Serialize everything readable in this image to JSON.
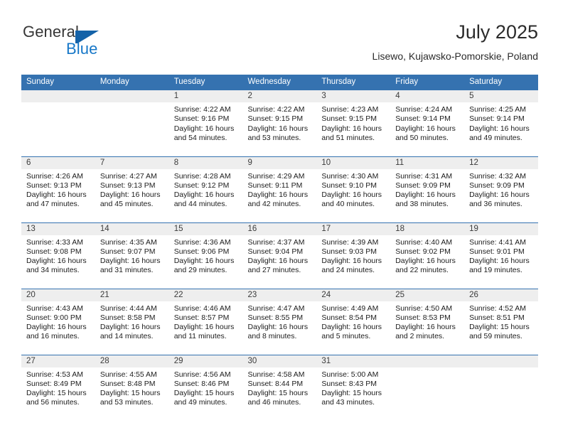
{
  "brand": {
    "name_top": "General",
    "name_bottom": "Blue",
    "flag_icon": "blue-flag-triangle-icon",
    "color_dark": "#363636",
    "color_blue": "#1878c8"
  },
  "header": {
    "title": "July 2025",
    "location": "Lisewo, Kujawsko-Pomorskie, Poland"
  },
  "theme": {
    "header_blue": "#3572b0",
    "daynum_band": "#eeeeee",
    "text": "#1c1c1c"
  },
  "labels": {
    "sunrise_prefix": "Sunrise:",
    "sunset_prefix": "Sunset:",
    "daylight_prefix": "Daylight:"
  },
  "weekdays": [
    "Sunday",
    "Monday",
    "Tuesday",
    "Wednesday",
    "Thursday",
    "Friday",
    "Saturday"
  ],
  "weeks": [
    [
      {
        "day": "",
        "empty": true
      },
      {
        "day": "",
        "empty": true
      },
      {
        "day": "1",
        "sunrise": "Sunrise: 4:22 AM",
        "sunset": "Sunset: 9:16 PM",
        "daylight_l1": "Daylight: 16 hours",
        "daylight_l2": "and 54 minutes."
      },
      {
        "day": "2",
        "sunrise": "Sunrise: 4:22 AM",
        "sunset": "Sunset: 9:15 PM",
        "daylight_l1": "Daylight: 16 hours",
        "daylight_l2": "and 53 minutes."
      },
      {
        "day": "3",
        "sunrise": "Sunrise: 4:23 AM",
        "sunset": "Sunset: 9:15 PM",
        "daylight_l1": "Daylight: 16 hours",
        "daylight_l2": "and 51 minutes."
      },
      {
        "day": "4",
        "sunrise": "Sunrise: 4:24 AM",
        "sunset": "Sunset: 9:14 PM",
        "daylight_l1": "Daylight: 16 hours",
        "daylight_l2": "and 50 minutes."
      },
      {
        "day": "5",
        "sunrise": "Sunrise: 4:25 AM",
        "sunset": "Sunset: 9:14 PM",
        "daylight_l1": "Daylight: 16 hours",
        "daylight_l2": "and 49 minutes."
      }
    ],
    [
      {
        "day": "6",
        "sunrise": "Sunrise: 4:26 AM",
        "sunset": "Sunset: 9:13 PM",
        "daylight_l1": "Daylight: 16 hours",
        "daylight_l2": "and 47 minutes."
      },
      {
        "day": "7",
        "sunrise": "Sunrise: 4:27 AM",
        "sunset": "Sunset: 9:13 PM",
        "daylight_l1": "Daylight: 16 hours",
        "daylight_l2": "and 45 minutes."
      },
      {
        "day": "8",
        "sunrise": "Sunrise: 4:28 AM",
        "sunset": "Sunset: 9:12 PM",
        "daylight_l1": "Daylight: 16 hours",
        "daylight_l2": "and 44 minutes."
      },
      {
        "day": "9",
        "sunrise": "Sunrise: 4:29 AM",
        "sunset": "Sunset: 9:11 PM",
        "daylight_l1": "Daylight: 16 hours",
        "daylight_l2": "and 42 minutes."
      },
      {
        "day": "10",
        "sunrise": "Sunrise: 4:30 AM",
        "sunset": "Sunset: 9:10 PM",
        "daylight_l1": "Daylight: 16 hours",
        "daylight_l2": "and 40 minutes."
      },
      {
        "day": "11",
        "sunrise": "Sunrise: 4:31 AM",
        "sunset": "Sunset: 9:09 PM",
        "daylight_l1": "Daylight: 16 hours",
        "daylight_l2": "and 38 minutes."
      },
      {
        "day": "12",
        "sunrise": "Sunrise: 4:32 AM",
        "sunset": "Sunset: 9:09 PM",
        "daylight_l1": "Daylight: 16 hours",
        "daylight_l2": "and 36 minutes."
      }
    ],
    [
      {
        "day": "13",
        "sunrise": "Sunrise: 4:33 AM",
        "sunset": "Sunset: 9:08 PM",
        "daylight_l1": "Daylight: 16 hours",
        "daylight_l2": "and 34 minutes."
      },
      {
        "day": "14",
        "sunrise": "Sunrise: 4:35 AM",
        "sunset": "Sunset: 9:07 PM",
        "daylight_l1": "Daylight: 16 hours",
        "daylight_l2": "and 31 minutes."
      },
      {
        "day": "15",
        "sunrise": "Sunrise: 4:36 AM",
        "sunset": "Sunset: 9:06 PM",
        "daylight_l1": "Daylight: 16 hours",
        "daylight_l2": "and 29 minutes."
      },
      {
        "day": "16",
        "sunrise": "Sunrise: 4:37 AM",
        "sunset": "Sunset: 9:04 PM",
        "daylight_l1": "Daylight: 16 hours",
        "daylight_l2": "and 27 minutes."
      },
      {
        "day": "17",
        "sunrise": "Sunrise: 4:39 AM",
        "sunset": "Sunset: 9:03 PM",
        "daylight_l1": "Daylight: 16 hours",
        "daylight_l2": "and 24 minutes."
      },
      {
        "day": "18",
        "sunrise": "Sunrise: 4:40 AM",
        "sunset": "Sunset: 9:02 PM",
        "daylight_l1": "Daylight: 16 hours",
        "daylight_l2": "and 22 minutes."
      },
      {
        "day": "19",
        "sunrise": "Sunrise: 4:41 AM",
        "sunset": "Sunset: 9:01 PM",
        "daylight_l1": "Daylight: 16 hours",
        "daylight_l2": "and 19 minutes."
      }
    ],
    [
      {
        "day": "20",
        "sunrise": "Sunrise: 4:43 AM",
        "sunset": "Sunset: 9:00 PM",
        "daylight_l1": "Daylight: 16 hours",
        "daylight_l2": "and 16 minutes."
      },
      {
        "day": "21",
        "sunrise": "Sunrise: 4:44 AM",
        "sunset": "Sunset: 8:58 PM",
        "daylight_l1": "Daylight: 16 hours",
        "daylight_l2": "and 14 minutes."
      },
      {
        "day": "22",
        "sunrise": "Sunrise: 4:46 AM",
        "sunset": "Sunset: 8:57 PM",
        "daylight_l1": "Daylight: 16 hours",
        "daylight_l2": "and 11 minutes."
      },
      {
        "day": "23",
        "sunrise": "Sunrise: 4:47 AM",
        "sunset": "Sunset: 8:55 PM",
        "daylight_l1": "Daylight: 16 hours",
        "daylight_l2": "and 8 minutes."
      },
      {
        "day": "24",
        "sunrise": "Sunrise: 4:49 AM",
        "sunset": "Sunset: 8:54 PM",
        "daylight_l1": "Daylight: 16 hours",
        "daylight_l2": "and 5 minutes."
      },
      {
        "day": "25",
        "sunrise": "Sunrise: 4:50 AM",
        "sunset": "Sunset: 8:53 PM",
        "daylight_l1": "Daylight: 16 hours",
        "daylight_l2": "and 2 minutes."
      },
      {
        "day": "26",
        "sunrise": "Sunrise: 4:52 AM",
        "sunset": "Sunset: 8:51 PM",
        "daylight_l1": "Daylight: 15 hours",
        "daylight_l2": "and 59 minutes."
      }
    ],
    [
      {
        "day": "27",
        "sunrise": "Sunrise: 4:53 AM",
        "sunset": "Sunset: 8:49 PM",
        "daylight_l1": "Daylight: 15 hours",
        "daylight_l2": "and 56 minutes."
      },
      {
        "day": "28",
        "sunrise": "Sunrise: 4:55 AM",
        "sunset": "Sunset: 8:48 PM",
        "daylight_l1": "Daylight: 15 hours",
        "daylight_l2": "and 53 minutes."
      },
      {
        "day": "29",
        "sunrise": "Sunrise: 4:56 AM",
        "sunset": "Sunset: 8:46 PM",
        "daylight_l1": "Daylight: 15 hours",
        "daylight_l2": "and 49 minutes."
      },
      {
        "day": "30",
        "sunrise": "Sunrise: 4:58 AM",
        "sunset": "Sunset: 8:44 PM",
        "daylight_l1": "Daylight: 15 hours",
        "daylight_l2": "and 46 minutes."
      },
      {
        "day": "31",
        "sunrise": "Sunrise: 5:00 AM",
        "sunset": "Sunset: 8:43 PM",
        "daylight_l1": "Daylight: 15 hours",
        "daylight_l2": "and 43 minutes."
      },
      {
        "day": "",
        "empty": true
      },
      {
        "day": "",
        "empty": true
      }
    ]
  ]
}
